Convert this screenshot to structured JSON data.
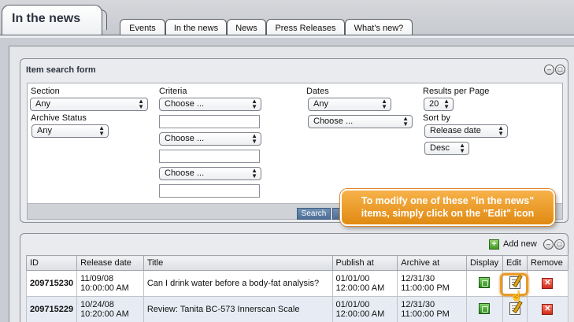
{
  "header": {
    "main_tab": "In the news",
    "tabs": [
      {
        "label": "Events"
      },
      {
        "label": "In the news"
      },
      {
        "label": "News"
      },
      {
        "label": "Press Releases"
      },
      {
        "label": "What's new?"
      }
    ]
  },
  "search_form": {
    "title": "Item search form",
    "section": {
      "label": "Section",
      "value": "Any"
    },
    "archive_status": {
      "label": "Archive Status",
      "value": "Any"
    },
    "criteria": {
      "label": "Criteria",
      "selects": [
        "Choose ...",
        "Choose ...",
        "Choose ..."
      ]
    },
    "dates": {
      "label": "Dates",
      "value": "Any",
      "value2": "Choose ..."
    },
    "results_per_page": {
      "label": "Results per Page",
      "value": "20"
    },
    "sort_by": {
      "label": "Sort by",
      "value": "Release date",
      "order": "Desc"
    },
    "search_button": "Search"
  },
  "callout": {
    "line1": "To modify one of these \"in the news\"",
    "line2": "items, simply click on the \"Edit\" icon"
  },
  "results": {
    "add_new": "Add new",
    "columns": [
      "ID",
      "Release date",
      "Title",
      "Publish at",
      "Archive at",
      "Display",
      "Edit",
      "Remove"
    ],
    "rows": [
      {
        "id": "209715230",
        "release_date": "11/09/08",
        "release_time": "10:00:00 AM",
        "title": "Can I drink water before a body-fat analysis?",
        "publish_date": "01/01/00",
        "publish_time": "12:00:00 AM",
        "archive_date": "12/31/30",
        "archive_time": "11:00:00 PM"
      },
      {
        "id": "209715229",
        "release_date": "10/24/08",
        "release_time": "10:20:00 AM",
        "title": "Review: Tanita BC-573 Innerscan Scale",
        "publish_date": "01/01/00",
        "publish_time": "12:00:00 AM",
        "archive_date": "12/31/30",
        "archive_time": "11:00:00 PM"
      }
    ]
  },
  "colors": {
    "callout": "#e8961f",
    "tab_border": "#5a5e66",
    "search_button": "#5a7ca3"
  }
}
